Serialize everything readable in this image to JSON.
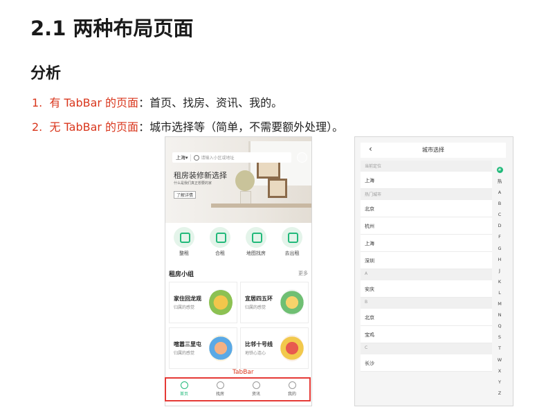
{
  "title": "2.1 两种布局页面",
  "subtitle": "分析",
  "points": [
    {
      "num": "1.",
      "red": "有 TabBar 的页面",
      "rest": "：首页、找房、资讯、我的。"
    },
    {
      "num": "2.",
      "red": "无 TabBar 的页面",
      "rest": "：城市选择等（简单，不需要额外处理）。"
    }
  ],
  "home": {
    "city": "上海▾",
    "search_placeholder": "请输入小区或地址",
    "banner_title": "租房装修新选择",
    "banner_sub": "什么是我们真正想要的家",
    "banner_btn": "了解详情",
    "nav": [
      "整租",
      "合租",
      "地图找房",
      "去出租"
    ],
    "group_title": "租房小组",
    "group_more": "更多",
    "cards": [
      {
        "title": "家住回龙观",
        "sub": "归属的感觉"
      },
      {
        "title": "宜居四五环",
        "sub": "归属的感觉"
      },
      {
        "title": "喧嚣三里屯",
        "sub": "归属的感觉"
      },
      {
        "title": "比邻十号线",
        "sub": "地铁心连心"
      }
    ],
    "tabbar_label": "TabBar",
    "tabs": [
      "首页",
      "找房",
      "资讯",
      "我的"
    ]
  },
  "citylist": {
    "title": "城市选择",
    "back": "‹",
    "rows": [
      {
        "type": "header",
        "text": "当前定位"
      },
      {
        "type": "item",
        "text": "上海"
      },
      {
        "type": "header",
        "text": "热门城市"
      },
      {
        "type": "item",
        "text": "北京"
      },
      {
        "type": "item",
        "text": "杭州"
      },
      {
        "type": "item",
        "text": "上海"
      },
      {
        "type": "item",
        "text": "深圳"
      },
      {
        "type": "header",
        "text": "A"
      },
      {
        "type": "item",
        "text": "安庆"
      },
      {
        "type": "header",
        "text": "B"
      },
      {
        "type": "item",
        "text": "北京"
      },
      {
        "type": "item",
        "text": "宝鸡"
      },
      {
        "type": "header",
        "text": "C"
      },
      {
        "type": "item",
        "text": "长沙"
      }
    ],
    "index": [
      "#",
      "热",
      "A",
      "B",
      "C",
      "D",
      "F",
      "G",
      "H",
      "J",
      "K",
      "L",
      "M",
      "N",
      "Q",
      "S",
      "T",
      "W",
      "X",
      "Y",
      "Z"
    ]
  },
  "colors": {
    "accent": "#21b97a",
    "red": "#d9361c"
  }
}
